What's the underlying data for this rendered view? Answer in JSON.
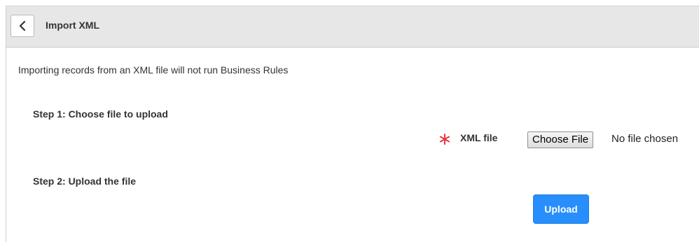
{
  "header": {
    "title": "Import XML",
    "back_icon": "chevron-left-icon"
  },
  "notice": "Importing records from an XML file will not run Business Rules",
  "steps": [
    {
      "label": "Step 1: Choose file to upload"
    },
    {
      "label": "Step 2: Upload the file"
    }
  ],
  "file_field": {
    "required_icon": "asterisk-icon",
    "label": "XML file",
    "button_label": "Choose File",
    "status": "No file chosen"
  },
  "upload": {
    "label": "Upload"
  },
  "colors": {
    "header_bg": "#e7e7e7",
    "required": "#e8343a",
    "primary_button": "#278efc"
  }
}
